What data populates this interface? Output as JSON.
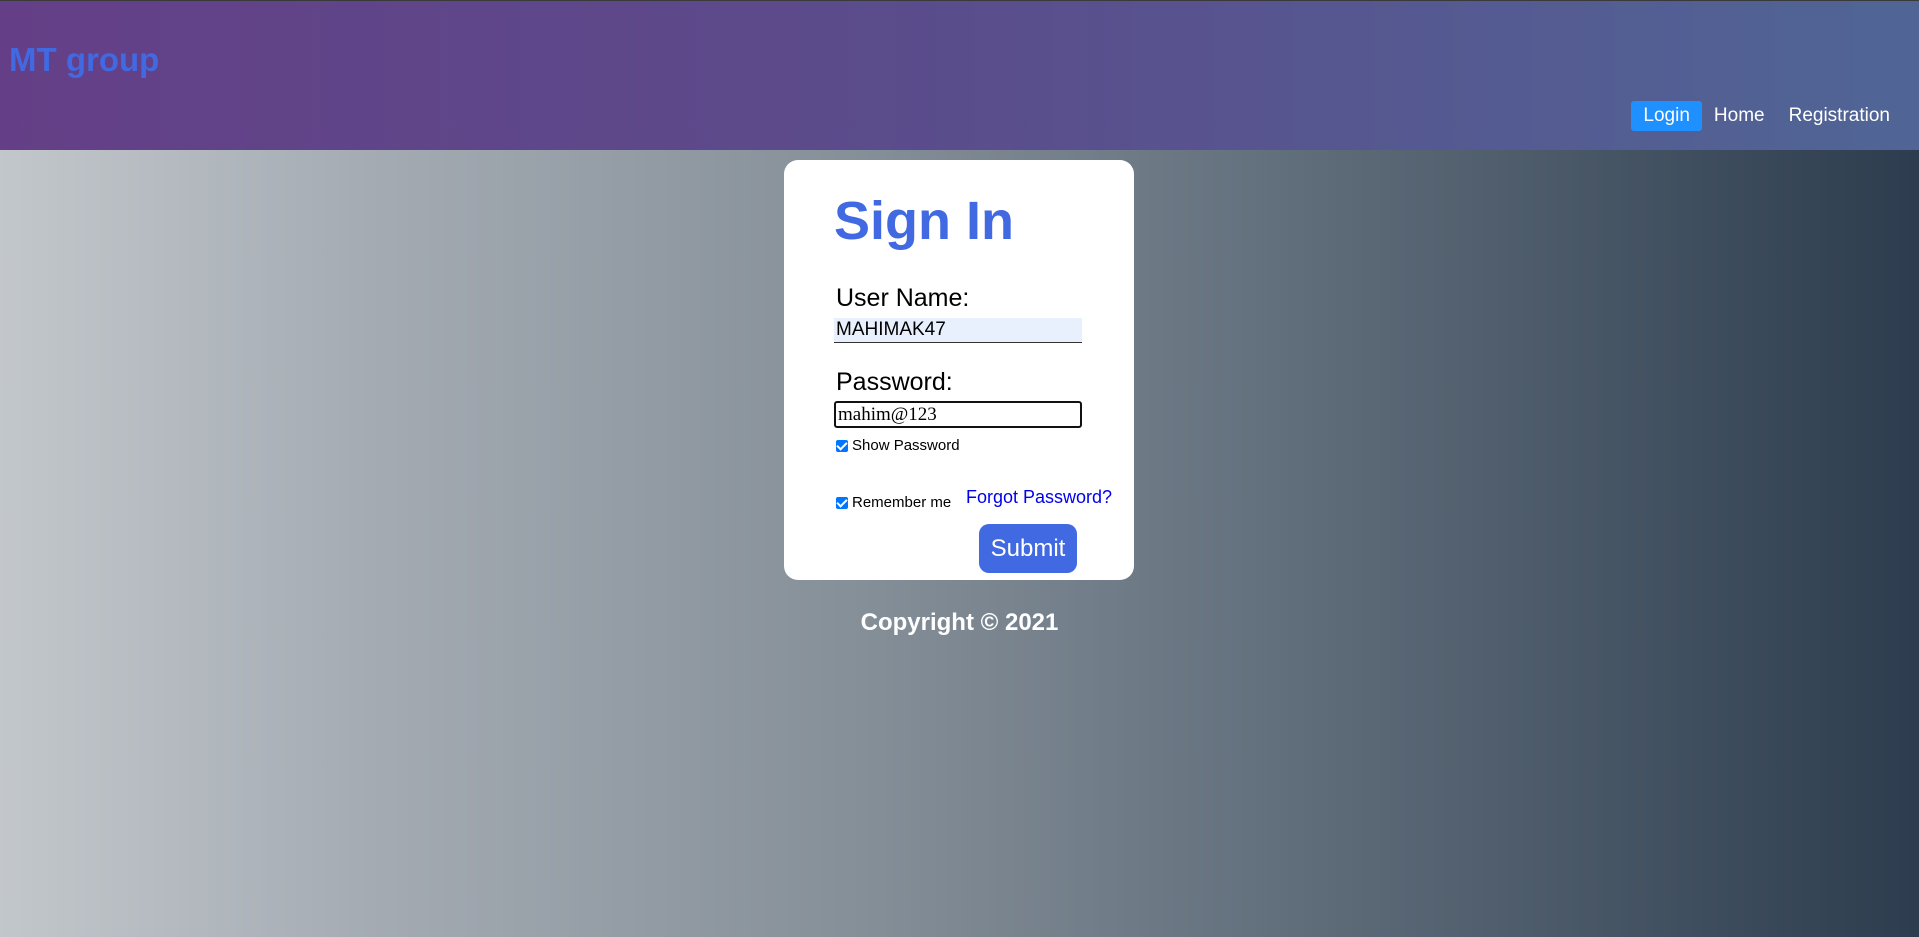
{
  "header": {
    "brand": "MT group",
    "nav": {
      "login": "Login",
      "home": "Home",
      "registration": "Registration"
    }
  },
  "signin": {
    "title": "Sign In",
    "username_label": "User Name:",
    "username_value": "MAHIMAK47",
    "password_label": "Password:",
    "password_value": "mahim@123",
    "show_password": "Show Password",
    "show_password_checked": true,
    "remember_me": "Remember me",
    "remember_me_checked": true,
    "forgot_password": "Forgot Password?",
    "submit": "Submit"
  },
  "footer": {
    "copyright": "Copyright © 2021"
  },
  "colors": {
    "brand_blue": "#4169e1",
    "active_nav": "#1e90ff",
    "link": "#0000ee"
  }
}
